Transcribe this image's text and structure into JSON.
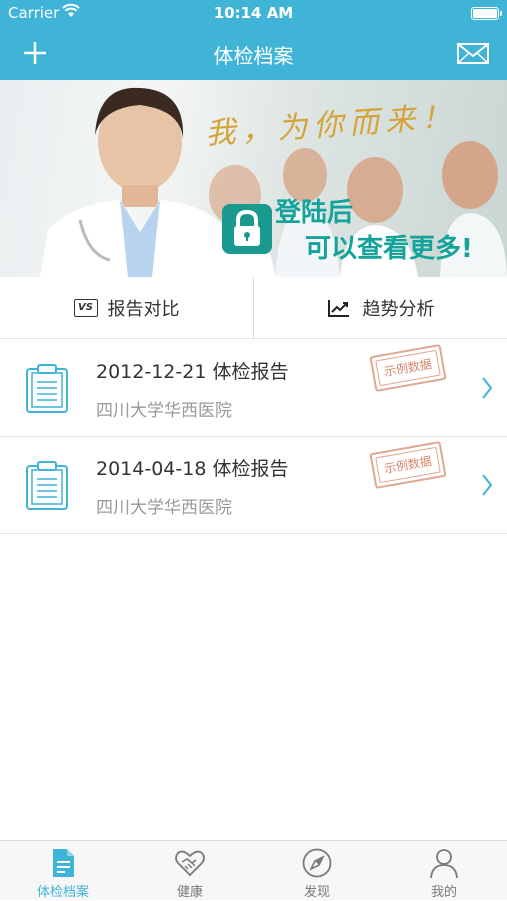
{
  "status_bar": {
    "carrier": "Carrier",
    "time": "10:14 AM",
    "battery_level": 1.0
  },
  "nav_bar": {
    "title": "体检档案",
    "left_icon": "plus-icon",
    "right_icon": "mail-icon",
    "color": "#3fb4d6"
  },
  "banner": {
    "slogan": "我，为你而来！",
    "login_line_1": "登陆后",
    "login_line_2": "可以查看更多!"
  },
  "actions": {
    "compare_icon_text": "VS",
    "compare_label": "报告对比",
    "trend_label": "趋势分析"
  },
  "reports": [
    {
      "title": "2012-12-21 体检报告",
      "hospital": "四川大学华西医院",
      "stamp": "示例数据"
    },
    {
      "title": "2014-04-18 体检报告",
      "hospital": "四川大学华西医院",
      "stamp": "示例数据"
    }
  ],
  "tab_bar": {
    "tabs": [
      {
        "label": "体检档案",
        "icon": "document-icon",
        "active": true
      },
      {
        "label": "健康",
        "icon": "handshake-icon",
        "active": false
      },
      {
        "label": "发现",
        "icon": "compass-icon",
        "active": false
      },
      {
        "label": "我的",
        "icon": "person-icon",
        "active": false
      }
    ],
    "active_color": "#3fb4d6",
    "inactive_color": "#7a7a7a"
  }
}
